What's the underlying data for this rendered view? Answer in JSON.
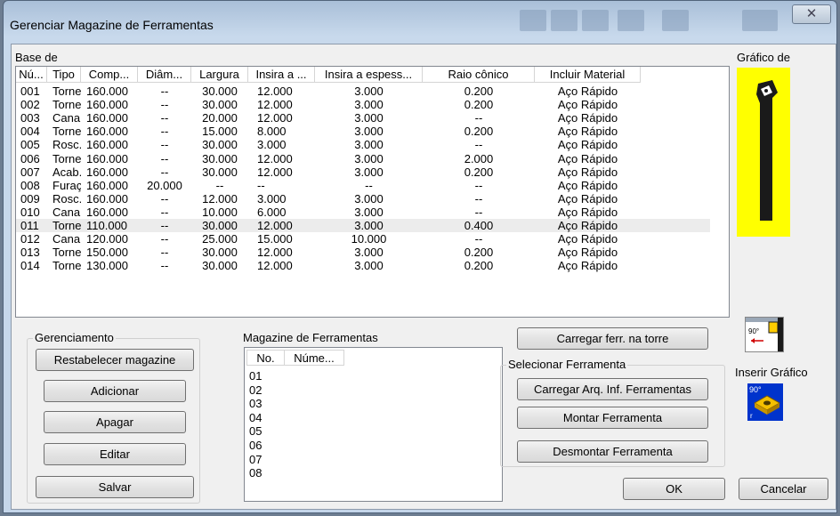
{
  "window": {
    "title": "Gerenciar Magazine de Ferramentas",
    "close_glyph": "✕"
  },
  "base": {
    "label": "Base de"
  },
  "graphic": {
    "label": "Gráfico de",
    "insert_label": "Inserir Gráfico",
    "angle_label": "90°",
    "small_label": "r",
    "yellow": "#ffff00"
  },
  "tool_table": {
    "columns": [
      "Nú...",
      "Tipo",
      "Comp...",
      "Diâm...",
      "Largura",
      "Insira a ...",
      "Insira a espess...",
      "Raio cônico",
      "Incluir Material"
    ],
    "rows": [
      [
        "001",
        "Torne...",
        "160.000",
        "--",
        "30.000",
        "12.000",
        "3.000",
        "0.200",
        "Aço Rápido"
      ],
      [
        "002",
        "Torne...",
        "160.000",
        "--",
        "30.000",
        "12.000",
        "3.000",
        "0.200",
        "Aço Rápido"
      ],
      [
        "003",
        "Canal ...",
        "160.000",
        "--",
        "20.000",
        "12.000",
        "3.000",
        "--",
        "Aço Rápido"
      ],
      [
        "004",
        "Torne...",
        "160.000",
        "--",
        "15.000",
        "8.000",
        "3.000",
        "0.200",
        "Aço Rápido"
      ],
      [
        "005",
        "Rosc...",
        "160.000",
        "--",
        "30.000",
        "3.000",
        "3.000",
        "--",
        "Aço Rápido"
      ],
      [
        "006",
        "Torne...",
        "160.000",
        "--",
        "30.000",
        "12.000",
        "3.000",
        "2.000",
        "Aço Rápido"
      ],
      [
        "007",
        "Acab...",
        "160.000",
        "--",
        "30.000",
        "12.000",
        "3.000",
        "0.200",
        "Aço Rápido"
      ],
      [
        "008",
        "Furaç...",
        "160.000",
        "20.000",
        "--",
        "--",
        "--",
        "--",
        "Aço Rápido"
      ],
      [
        "009",
        "Rosc...",
        "160.000",
        "--",
        "12.000",
        "3.000",
        "3.000",
        "--",
        "Aço Rápido"
      ],
      [
        "010",
        "Canal ...",
        "160.000",
        "--",
        "10.000",
        "6.000",
        "3.000",
        "--",
        "Aço Rápido"
      ],
      [
        "011",
        "Torne...",
        "110.000",
        "--",
        "30.000",
        "12.000",
        "3.000",
        "0.400",
        "Aço Rápido"
      ],
      [
        "012",
        "Canal ...",
        "120.000",
        "--",
        "25.000",
        "15.000",
        "10.000",
        "--",
        "Aço Rápido"
      ],
      [
        "013",
        "Torne...",
        "150.000",
        "--",
        "30.000",
        "12.000",
        "3.000",
        "0.200",
        "Aço Rápido"
      ],
      [
        "014",
        "Torne...",
        "130.000",
        "--",
        "30.000",
        "12.000",
        "3.000",
        "0.200",
        "Aço Rápido"
      ]
    ]
  },
  "management": {
    "title": "Gerenciamento",
    "buttons": [
      "Restabelecer magazine",
      "Adicionar",
      "Apagar",
      "Editar",
      "Salvar"
    ]
  },
  "magazine": {
    "title": "Magazine de Ferramentas",
    "columns": [
      "No.",
      "Núme..."
    ],
    "rows": [
      "01",
      "02",
      "03",
      "04",
      "05",
      "06",
      "07",
      "08"
    ]
  },
  "load_turret": "Carregar ferr. na torre",
  "select_tool": {
    "title": "Selecionar Ferramenta",
    "buttons": [
      "Carregar Arq. Inf. Ferramentas",
      "Montar Ferramenta",
      "Desmontar Ferramenta"
    ]
  },
  "ok": "OK",
  "cancel": "Cancelar"
}
